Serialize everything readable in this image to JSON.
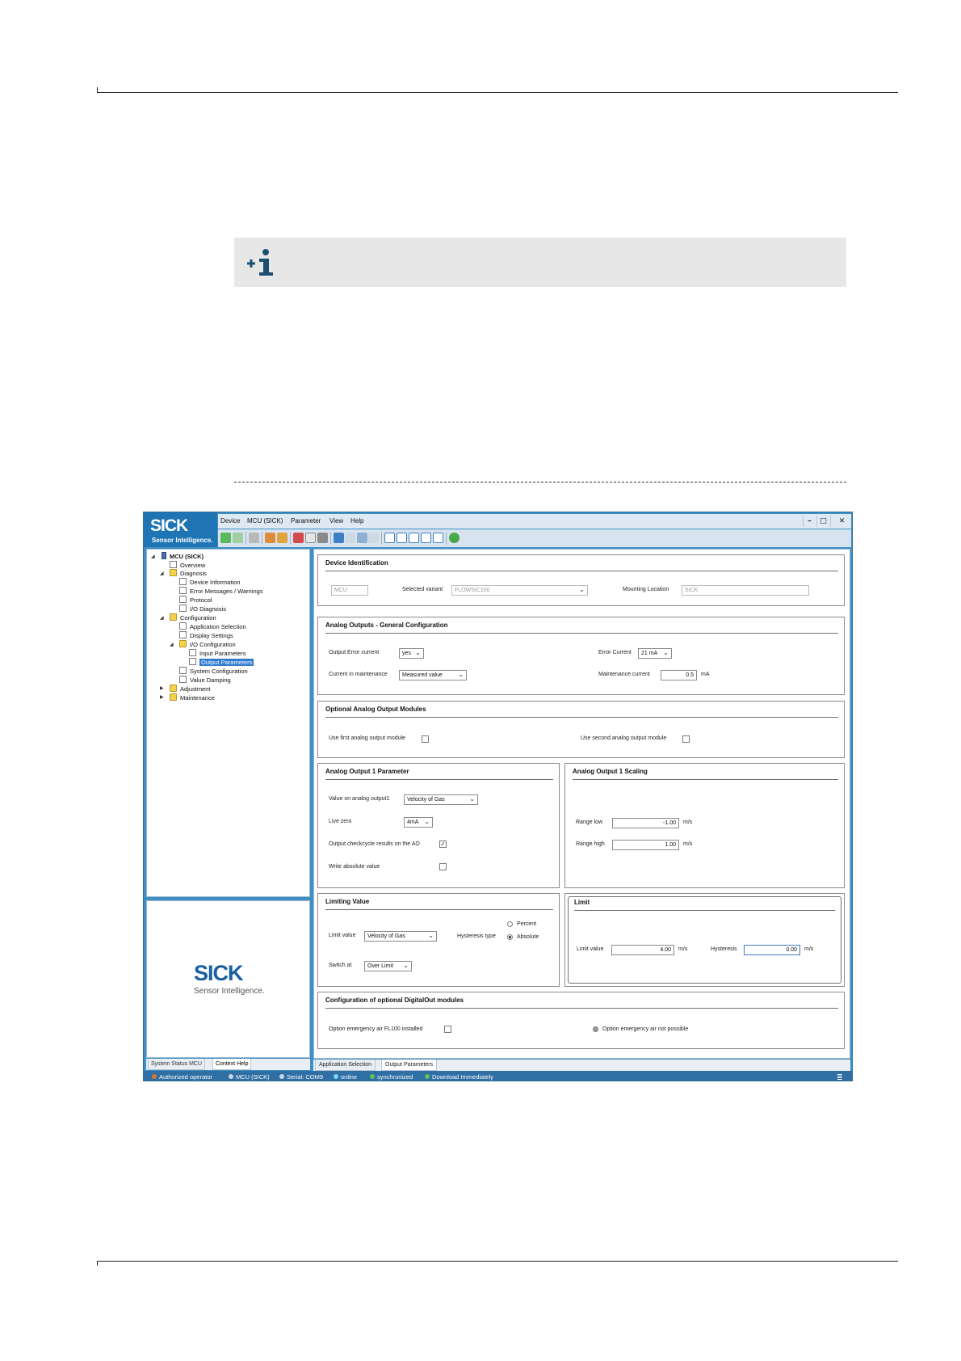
{
  "app": {
    "brand_logo": "SICK",
    "brand_tagline": "Sensor Intelligence.",
    "menu": [
      "Device",
      "MCU (SICK)",
      "Parameter",
      "View",
      "Help"
    ],
    "window_buttons": {
      "minimize": "–",
      "maximize": "□",
      "close": "✕"
    }
  },
  "tree": {
    "root": "MCU (SICK)",
    "overview": "Overview",
    "diagnosis": "Diagnosis",
    "device_information": "Device Information",
    "error_messages": "Error Messages / Warnings",
    "protocol": "Protocol",
    "io_diagnosis": "I/O Diagnosis",
    "configuration": "Configuration",
    "application_selection": "Application Selection",
    "display_settings": "Display Settings",
    "io_configuration": "I/O Configuration",
    "input_parameters": "Input Parameters",
    "output_parameters": "Output Parameters",
    "system_configuration": "System Configuration",
    "value_damping": "Value Damping",
    "adjustment": "Adjustment",
    "maintenance": "Maintenance"
  },
  "left_tabs": [
    "System Status MCU",
    "Context Help"
  ],
  "logo_panel": {
    "logo": "SICK",
    "tagline": "Sensor Intelligence."
  },
  "device_identification": {
    "title": "Device Identification",
    "device_value": "MCU",
    "selected_variant_label": "Selected variant",
    "selected_variant_value": "FLOWSIC100",
    "mounting_location_label": "Mounting Location",
    "mounting_location_value": "SICK"
  },
  "analog_general": {
    "title": "Analog Outputs - General Configuration",
    "output_error_current_label": "Output Error current",
    "output_error_current_value": "yes",
    "error_current_label": "Error Current",
    "error_current_value": "21 mA",
    "current_in_maintenance_label": "Current in maintenance",
    "current_in_maintenance_value": "Measured value",
    "maintenance_current_label": "Maintenance current",
    "maintenance_current_value": "0.5",
    "maintenance_current_unit": "mA"
  },
  "optional_modules": {
    "title": "Optional Analog Output Modules",
    "first_label": "Use first analog output module",
    "second_label": "Use second analog output module"
  },
  "ao1_param": {
    "title": "Analog Output 1 Parameter",
    "value_label": "Value on analog output1",
    "value_value": "Velocity of Gas",
    "live_zero_label": "Live zero",
    "live_zero_value": "4mA",
    "checkcycle_label": "Output checkcycle results on the AO",
    "checkcycle_checked": "✓",
    "write_absolute_label": "Write absolute value"
  },
  "ao1_scaling": {
    "title": "Analog Output 1 Scaling",
    "range_low_label": "Range low",
    "range_low_value": "-1.00",
    "range_high_label": "Range high",
    "range_high_value": "1.00",
    "unit": "m/s"
  },
  "limiting_value": {
    "title": "Limiting Value",
    "limit_value_label": "Limit value",
    "limit_value_value": "Velocity of Gas",
    "hysteresis_type_label": "Hysteresis type",
    "percent_label": "Percent",
    "absolute_label": "Absolute",
    "switch_at_label": "Switch at",
    "switch_at_value": "Over Limit"
  },
  "limit": {
    "title": "Limit",
    "limit_value_label": "Limit value",
    "limit_value_value": "4.00",
    "unit": "m/s",
    "hysteresis_label": "Hysteresis",
    "hysteresis_value": "0.00"
  },
  "digital_out": {
    "title": "Configuration of optional DigitalOut modules",
    "emergency_label": "Option emergency air FL100 installed",
    "not_possible_label": "Option emergency air not possible"
  },
  "main_tabs": [
    "Application Selection",
    "Output Parameters"
  ],
  "status": {
    "user": "Authorized operator",
    "device": "MCU (SICK)",
    "serial": "Serial: COM9",
    "online": "online",
    "sync": "synchronized",
    "download": "Download Immediately"
  }
}
